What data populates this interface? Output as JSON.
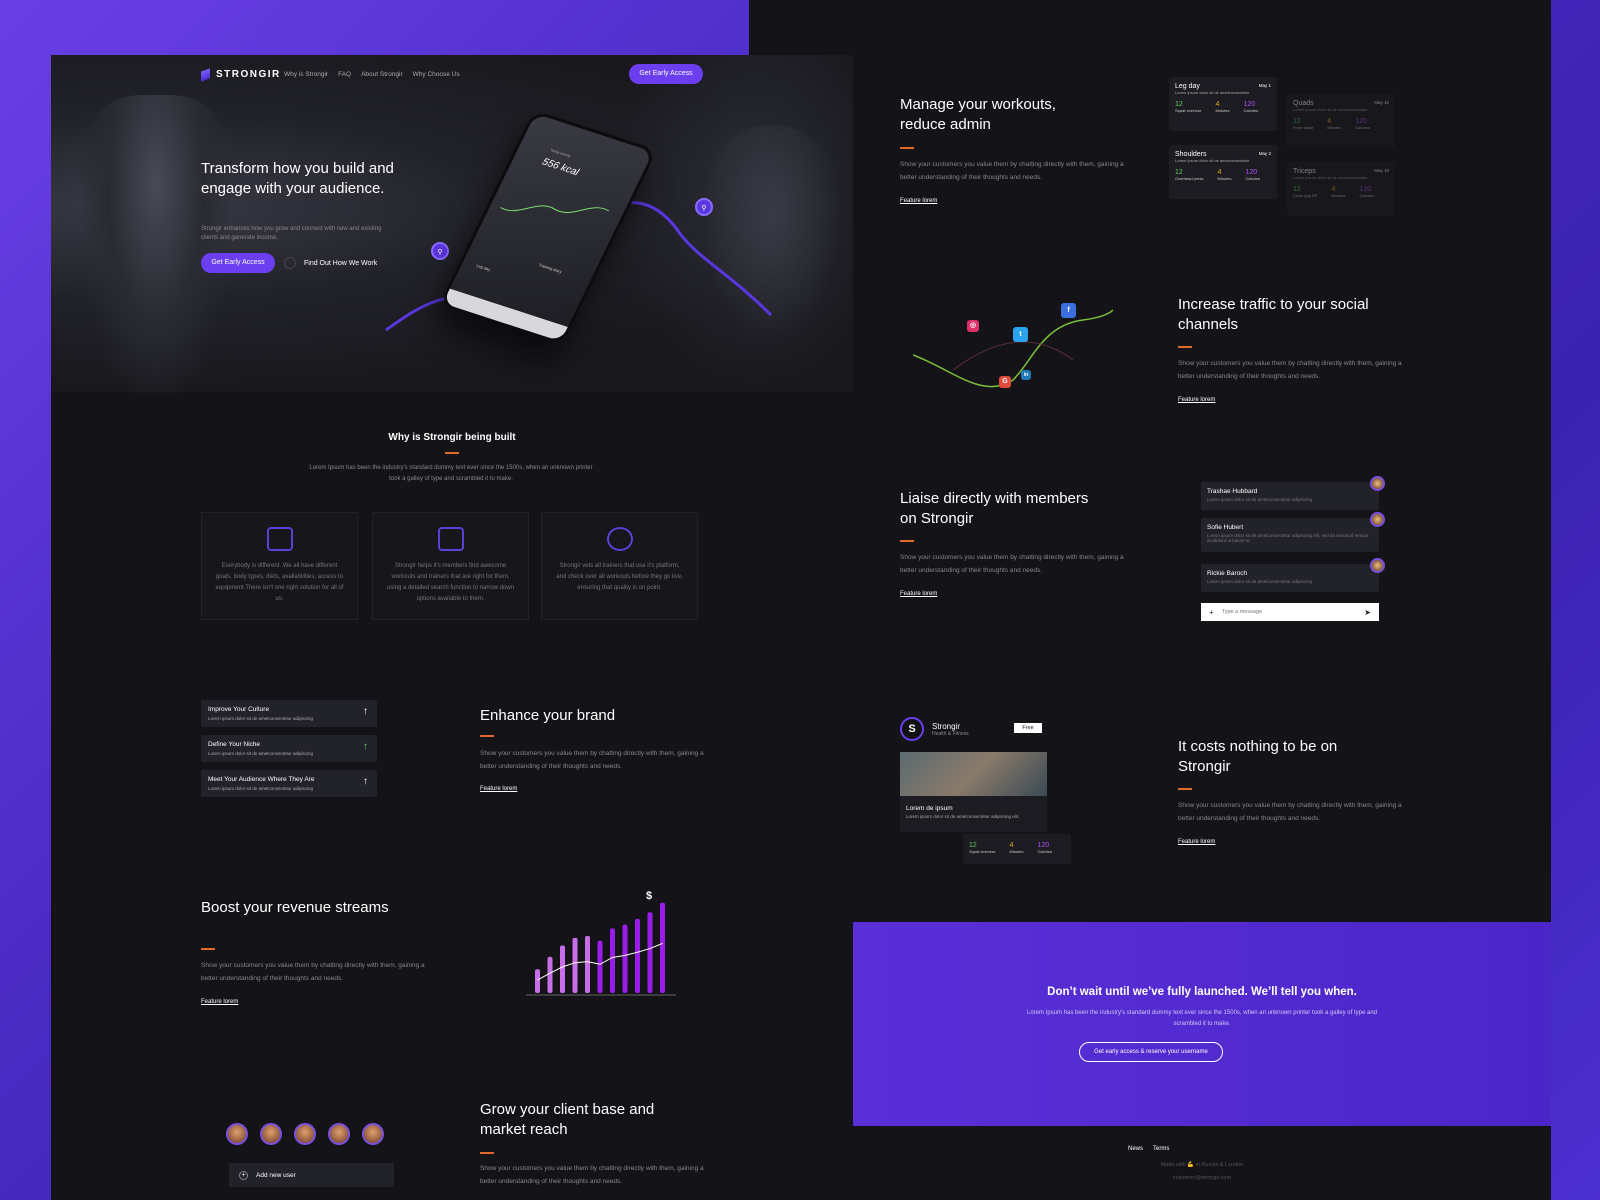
{
  "brand": {
    "name": "STRONGIR"
  },
  "nav": {
    "items": [
      "Why is Strongir",
      "FAQ",
      "About Strongir",
      "Why Choose Us"
    ],
    "cta": "Get Early Access"
  },
  "hero": {
    "title": "Transform how you build and engage with your audience.",
    "subtitle": "Strongir enhances how you grow and connect with new and existing clients and generate income.",
    "cta": "Get Early Access",
    "secondary": "Find Out How We Work",
    "phone": {
      "label": "Today activity",
      "kcal": "556 kcal",
      "diary": "Training diary",
      "day": "Leg day"
    }
  },
  "why": {
    "title": "Why is Strongir being built",
    "text": "Lorem Ipsum has been the industry's standard dummy text ever since the 1500s, when an unknown printer took a galley of type and scrambled it to make.",
    "cards": [
      {
        "icon": "building-icon",
        "text": "Everybody is different. We all have different goals, body types, diets, availabilities, access to equipment.There isn't one right solution for all of us."
      },
      {
        "icon": "trainers-icon",
        "text": "Strongir helps it's members find awesome workouts and trainers that are right for them, using a detailed search function to narrow down options available to them."
      },
      {
        "icon": "badge-icon",
        "text": "Strongir vets all trainers that use it's platform, and check over all workouts before they go live, ensuring that quality is on point."
      }
    ]
  },
  "brandList": [
    {
      "title": "Improve Your Culture",
      "sub": "Lorem ipsum dolor sit de ametconsectetur adipiscing"
    },
    {
      "title": "Define Your Niche",
      "sub": "Lorem ipsum dolor sit de ametconsectetur adipiscing"
    },
    {
      "title": "Meet Your Audience Where They Are",
      "sub": "Lorem ipsum dolor sit de ametconsectetur adipiscing"
    }
  ],
  "features": {
    "brand": {
      "title": "Enhance your brand",
      "text": "Show your customers you value them by chatting directly with them, gaining a better understanding of their thoughts and needs.",
      "link": "Feature lorem"
    },
    "revenue": {
      "title": "Boost your revenue streams",
      "text": "Show your customers you value them by chatting directly with them, gaining a better understanding of their thoughts and needs.",
      "link": "Feature lorem"
    },
    "client": {
      "title": "Grow your client base and market reach",
      "text": "Show your customers you value them by chatting directly with them, gaining a better understanding of their thoughts and needs."
    },
    "workouts": {
      "title": "Manage your workouts, reduce admin",
      "text": "Show your customers you value them by chatting directly with them, gaining a better understanding of their thoughts and needs.",
      "link": "Feature lorem"
    },
    "social": {
      "title": "Increase traffic to your social channels",
      "text": "Show your customers you value them by chatting directly with them, gaining a better understanding of their thoughts and needs.",
      "link": "Feature lorem"
    },
    "liaise": {
      "title": "Liaise directly with members on Strongir",
      "text": "Show your customers you value them by chatting directly with them, gaining a better understanding of their thoughts and needs.",
      "link": "Feature lorem"
    },
    "free": {
      "title": "It costs nothing to be on Strongir",
      "text": "Show your customers you value them by chatting directly with them, gaining a better understanding of their thoughts and needs.",
      "link": "Feature lorem"
    }
  },
  "revenueBars": [
    0.25,
    0.38,
    0.5,
    0.58,
    0.6,
    0.55,
    0.68,
    0.72,
    0.78,
    0.85,
    0.95
  ],
  "addUser": "Add new user",
  "workoutCards": [
    {
      "title": "Leg day",
      "date": "May 1",
      "desc": "Lorem ipsum dolor sit de ametconsectetur",
      "stats": [
        {
          "v": "12",
          "l": "Squat exercise"
        },
        {
          "v": "4",
          "l": "Minutes"
        },
        {
          "v": "120",
          "l": "Calories"
        }
      ]
    },
    {
      "title": "Shoulders",
      "date": "May 2",
      "desc": "Lorem ipsum dolor sit de ametconsectetur",
      "stats": [
        {
          "v": "12",
          "l": "Overhead press"
        },
        {
          "v": "4",
          "l": "Minutes"
        },
        {
          "v": "120",
          "l": "Calories"
        }
      ]
    },
    {
      "title": "Quads",
      "date": "May 10",
      "desc": "Lorem ipsum dolor sit de ametconsectetur",
      "stats": [
        {
          "v": "12",
          "l": "Front squat"
        },
        {
          "v": "4",
          "l": "Minutes"
        },
        {
          "v": "120",
          "l": "Calories"
        }
      ]
    },
    {
      "title": "Triceps",
      "date": "May 10",
      "desc": "Lorem ipsum dolor sit de ametconsectetur",
      "stats": [
        {
          "v": "12",
          "l": "Close grip BP"
        },
        {
          "v": "4",
          "l": "Minutes"
        },
        {
          "v": "120",
          "l": "Calories"
        }
      ]
    }
  ],
  "chats": [
    {
      "name": "Trashae Hubbard",
      "msg": "Lorem ipsum dolor sit de ametconsectetur adipiscing"
    },
    {
      "name": "Sofie Hubert",
      "msg": "Lorem ipsum dolor sit de ametconsectetur adipiscing elit, sed do eiusmod tempor incididunt ut labore et"
    },
    {
      "name": "Rickie Baroch",
      "msg": "Lorem ipsum dolor sit de ametconsectetur adipiscing"
    }
  ],
  "chatInput": {
    "placeholder": "Type a message"
  },
  "profile": {
    "initial": "S",
    "name": "Strongir",
    "category": "Health & Fitness",
    "badge": "Free",
    "postTitle": "Lorem de ipsum",
    "postText": "Lorem ipsum dolor sit de ametconsectetur adipiscing elit.",
    "stats": [
      {
        "v": "12",
        "l": "Squat exercise"
      },
      {
        "v": "4",
        "l": "Minutes"
      },
      {
        "v": "120",
        "l": "Calories"
      }
    ]
  },
  "cta": {
    "title": "Don’t wait until we’ve fully launched. We’ll tell you when.",
    "text": "Lorem Ipsum has been the industry's standard dummy text ever since the 1500s, when an unknown printer took a galley of type and scrambled it to make.",
    "button": "Get early access & reserve your username"
  },
  "footer": {
    "links": [
      "News",
      "Terms"
    ],
    "made": "Made with 💪 in Russia & London",
    "email": "customer@strongir.com"
  },
  "colors": {
    "accent": "#6b3ff0",
    "orange": "#e4682a",
    "green": "#5bd55b",
    "yellow": "#e8b020",
    "purple": "#b050f0"
  }
}
